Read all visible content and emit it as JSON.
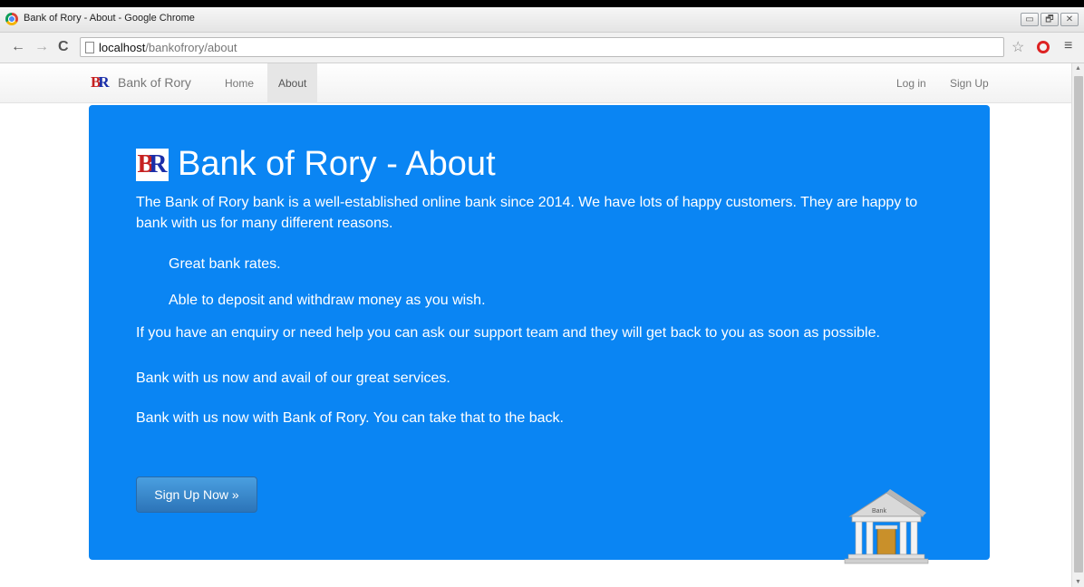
{
  "window": {
    "title": "Bank of Rory - About - Google Chrome",
    "controls": {
      "minimize": "▭",
      "restore": "🗗",
      "close": "✕"
    }
  },
  "browser": {
    "back": "←",
    "forward": "→",
    "reload": "C",
    "url_host": "localhost",
    "url_path": "/bankofrory/about",
    "star_icon": "☆",
    "menu_icon": "≡"
  },
  "nav": {
    "brand": "Bank of Rory",
    "logo_letters": {
      "first": "B",
      "second": "R"
    },
    "links": {
      "home": "Home",
      "about": "About",
      "login": "Log in",
      "signup": "Sign Up"
    }
  },
  "hero": {
    "title": "Bank of Rory - About",
    "p1": "The Bank of Rory bank is a well-established online bank since 2014. We have lots of happy customers. They are happy to bank with us for many different reasons.",
    "bullet1": "Great bank rates.",
    "bullet2": "Able to deposit and withdraw money as you wish.",
    "p2": "If you have an enquiry or need help you can ask our support team and they will get back to you as soon as possible.",
    "p3": "Bank with us now and avail of our great services.",
    "p4": "Bank with us now with Bank of Rory. You can take that to the back.",
    "cta": "Sign Up Now »",
    "bank_sign": "Bank"
  },
  "colors": {
    "hero_bg": "#0a85f3",
    "button": "#2c74b8",
    "logo_red": "#c62020",
    "logo_blue": "#1b2ea8"
  }
}
